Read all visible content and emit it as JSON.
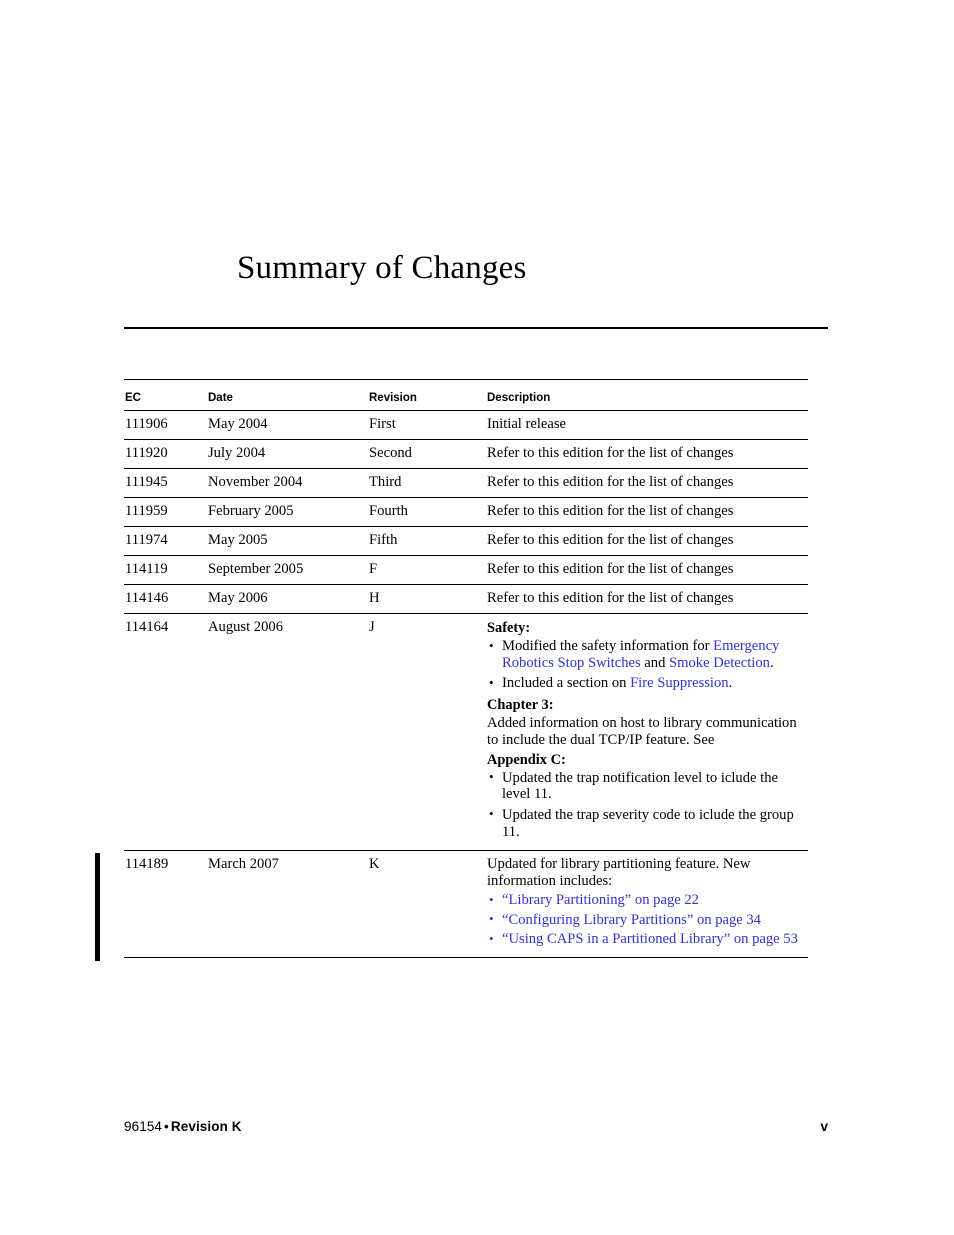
{
  "document": {
    "title": "Summary of Changes"
  },
  "table": {
    "columns": [
      "EC",
      "Date",
      "Revision",
      "Description"
    ],
    "rows": [
      {
        "ec": "111906",
        "date": "May 2004",
        "revision": "First",
        "description": "Initial release"
      },
      {
        "ec": "111920",
        "date": "July 2004",
        "revision": "Second",
        "description": "Refer to this edition for the list of changes"
      },
      {
        "ec": "111945",
        "date": "November 2004",
        "revision": "Third",
        "description": "Refer to this edition for the list of changes"
      },
      {
        "ec": "111959",
        "date": "February 2005",
        "revision": "Fourth",
        "description": "Refer to this edition for the list of changes"
      },
      {
        "ec": "111974",
        "date": "May 2005",
        "revision": "Fifth",
        "description": "Refer to this edition for the list of changes"
      },
      {
        "ec": "114119",
        "date": "September 2005",
        "revision": "F",
        "description": "Refer to this edition for the list of changes"
      },
      {
        "ec": "114146",
        "date": "May 2006",
        "revision": "H",
        "description": "Refer to this edition for the list of changes"
      },
      {
        "ec": "114164",
        "date": "August 2006",
        "revision": "J",
        "description": ""
      },
      {
        "ec": "114189",
        "date": "March 2007",
        "revision": "K",
        "description": ""
      }
    ]
  },
  "row_j_content": {
    "safety_heading": "Safety:",
    "safety_bullet_1": {
      "text_1": "Modified the safety information for ",
      "link_1": "Emergency Robotics Stop Switches",
      "text_2": " and ",
      "link_2": "Smoke Detection",
      "text_3": "."
    },
    "safety_bullet_2": {
      "text_1": "Included a section on ",
      "link_1": "Fire Suppression",
      "text_2": "."
    },
    "chapter_heading": "Chapter 3:",
    "chapter_para": "Added information on host to library communication to include the dual TCP/IP feature. See",
    "appendix_heading": "Appendix C:",
    "appendix_bullet_1": "Updated the trap notification level to iclude the level 11.",
    "appendix_bullet_2": "Updated the trap severity code to iclude the group 11."
  },
  "row_k_content": {
    "intro": "Updated for library partitioning feature. New information includes:",
    "links": [
      "“Library Partitioning” on page 22",
      "“Configuring Library Partitions” on page 34",
      "“Using CAPS in a Partitioned Library” on page 53"
    ]
  },
  "footer": {
    "doc_number": "96154",
    "separator": "•",
    "revision": "Revision K",
    "page_number": "v"
  },
  "colors": {
    "link_blue": "#3333cc",
    "text_black": "#000000",
    "page_background": "#ffffff"
  }
}
